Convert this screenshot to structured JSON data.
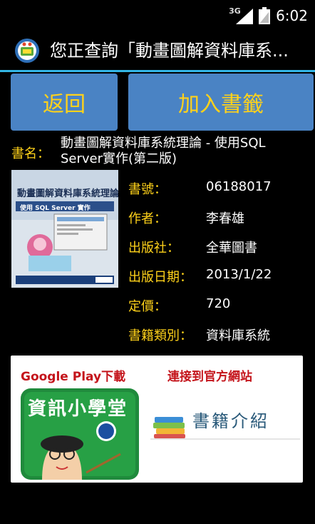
{
  "status_bar": {
    "network": "3G",
    "time": "6:02"
  },
  "action_bar": {
    "title": "您正查詢「動畫圖解資料庫系..."
  },
  "buttons": {
    "back": "返回",
    "bookmark": "加入書籤"
  },
  "book": {
    "title_label": "書名：",
    "title": "動畫圖解資料庫系統理論 - 使用SQL Server實作(第二版)",
    "fields": [
      {
        "label": "書號：",
        "value": "06188017"
      },
      {
        "label": "作者：",
        "value": "李春雄"
      },
      {
        "label": "出版社：",
        "value": "全華圖書"
      },
      {
        "label": "出版日期：",
        "value": "2013/1/22"
      },
      {
        "label": "定價：",
        "value": "720"
      },
      {
        "label": "書籍類別：",
        "value": "資料庫系統"
      }
    ],
    "cover_text": "動畫圖解資料庫系統理論",
    "cover_subtext": "使用 SQL Server 實作"
  },
  "promo": {
    "google_play_label": "Google Play下載",
    "official_site_label": "連接到官方網站",
    "app_icon_text": "資訊小學堂",
    "book_intro_text": "書籍介紹"
  },
  "colors": {
    "accent": "#33b5e5",
    "button": "#4a83c4",
    "label": "#ffd21a",
    "promo_red": "#c4141b"
  }
}
